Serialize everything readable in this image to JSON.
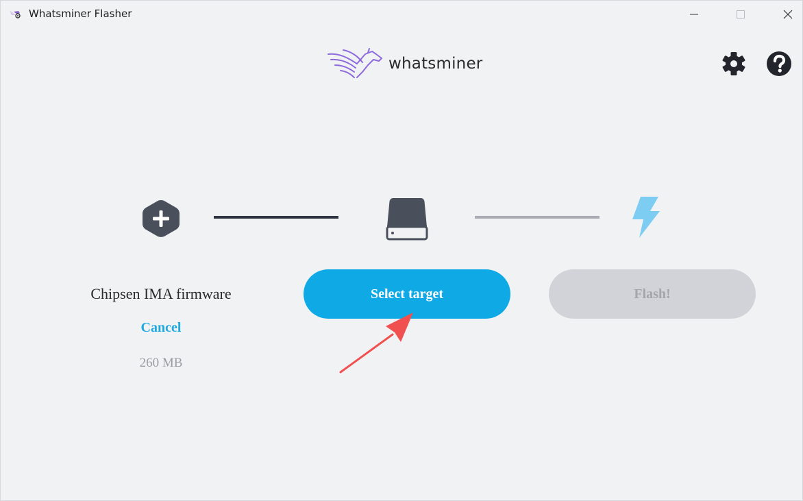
{
  "window": {
    "title": "Whatsminer Flasher",
    "controls": [
      "minimize",
      "maximize",
      "close"
    ]
  },
  "header": {
    "logo_text": "whatsminer",
    "icons": [
      "settings-gear-icon",
      "help-question-icon"
    ]
  },
  "steps": {
    "source": {
      "icon": "plus-hexagon-icon",
      "file_name": "Chipsen IMA firmware",
      "cancel_label": "Cancel",
      "size": "260 MB"
    },
    "target": {
      "icon": "drive-icon",
      "button_label": "Select target"
    },
    "flash": {
      "icon": "lightning-bolt-icon",
      "button_label": "Flash!",
      "enabled": false
    }
  },
  "colors": {
    "accent": "#0faae6",
    "icon_dark": "#4a4f5c",
    "disabled": "#d2d3d8",
    "annotation_arrow": "#f0504f"
  }
}
